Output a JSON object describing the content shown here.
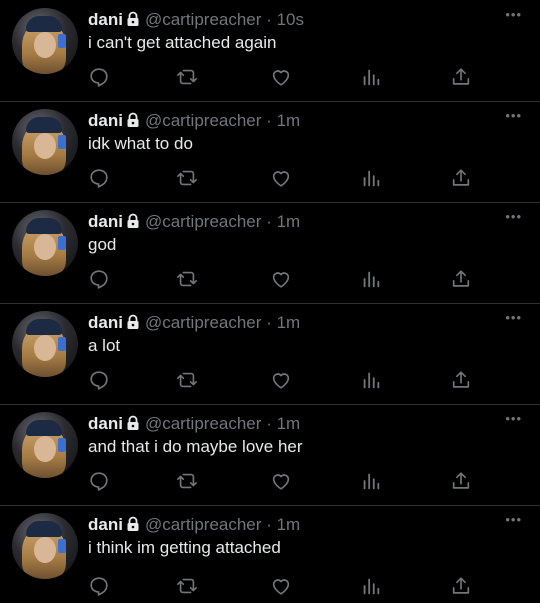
{
  "colors": {
    "background": "#000000",
    "text": "#e7e9ea",
    "muted": "#71767b",
    "divider": "#2f3336"
  },
  "tweets": [
    {
      "name": "dani",
      "handle": "@cartipreacher",
      "separator": "·",
      "time": "10s",
      "text": "i can't get attached again",
      "more": "•••"
    },
    {
      "name": "dani",
      "handle": "@cartipreacher",
      "separator": "·",
      "time": "1m",
      "text": "idk what to do",
      "more": "•••"
    },
    {
      "name": "dani",
      "handle": "@cartipreacher",
      "separator": "·",
      "time": "1m",
      "text": "god",
      "more": "•••"
    },
    {
      "name": "dani",
      "handle": "@cartipreacher",
      "separator": "·",
      "time": "1m",
      "text": "a lot",
      "more": "•••"
    },
    {
      "name": "dani",
      "handle": "@cartipreacher",
      "separator": "·",
      "time": "1m",
      "text": "and that i do maybe love her",
      "more": "•••"
    },
    {
      "name": "dani",
      "handle": "@cartipreacher",
      "separator": "·",
      "time": "1m",
      "text": "i think im getting attached",
      "more": "•••"
    }
  ],
  "icons": [
    "reply-icon",
    "retweet-icon",
    "like-icon",
    "views-icon",
    "share-icon",
    "lock-icon",
    "more-icon"
  ]
}
